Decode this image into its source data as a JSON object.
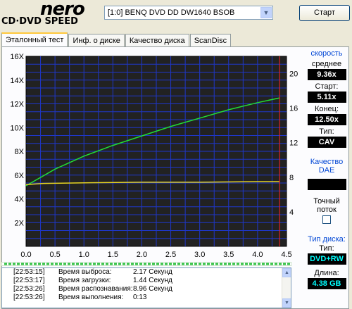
{
  "logo": {
    "brand": "nero",
    "product": "CD·DVD SPEED"
  },
  "drive": {
    "selected": "[1:0]  BENQ DVD DD DW1640 BSOB"
  },
  "start_button": "Старт",
  "tabs": [
    {
      "label": "Эталонный тест",
      "active": true
    },
    {
      "label": "Инф. о диске",
      "active": false
    },
    {
      "label": "Качество диска",
      "active": false
    },
    {
      "label": "ScanDisc",
      "active": false
    }
  ],
  "speed_panel": {
    "title": "скорость",
    "avg_label": "среднее",
    "avg_value": "9.36x",
    "start_label": "Старт:",
    "start_value": "5.11x",
    "end_label": "Конец:",
    "end_value": "12.50x",
    "type_label": "Тип:",
    "type_value": "CAV"
  },
  "dae_panel": {
    "title": "Качество DAE",
    "value": "",
    "precise_label_1": "Точный",
    "precise_label_2": "поток"
  },
  "disc_panel": {
    "title": "Тип диска:",
    "type_label": "Тип:",
    "type_value": "DVD+RW",
    "length_label": "Длина:",
    "length_value": "4.38 GB"
  },
  "log": [
    {
      "time": "[22:53:15]",
      "key": "Время выброса:",
      "value": "2.17 Секунд"
    },
    {
      "time": "[22:53:17]",
      "key": "Время загрузки:",
      "value": "1.44 Секунд"
    },
    {
      "time": "[22:53:26]",
      "key": "Время распознавания:",
      "value": "8.96 Секунд"
    },
    {
      "time": "[22:53:26]",
      "key": "Время выполнения:",
      "value": "0:13"
    }
  ],
  "colors": {
    "accent": "#0046d5",
    "plot_bg": "#222222",
    "grid": "#1f37c9",
    "speed_line": "#22dd33",
    "secondary_line": "#e6d422",
    "marker": "#ff2222"
  },
  "chart_data": {
    "type": "line",
    "xlim": [
      0,
      4.5
    ],
    "ylim": [
      0,
      16
    ],
    "y2lim": [
      0,
      22
    ],
    "x_ticks": [
      "0.0",
      "0.5",
      "1.0",
      "1.5",
      "2.0",
      "2.5",
      "3.0",
      "3.5",
      "4.0",
      "4.5"
    ],
    "y_ticks": [
      "2X",
      "4X",
      "6X",
      "8X",
      "10X",
      "12X",
      "14X",
      "16X"
    ],
    "y2_ticks": [
      "4",
      "8",
      "12",
      "16",
      "20"
    ],
    "grid": true,
    "series": [
      {
        "axis": "left",
        "color": "#22dd33",
        "x": [
          0,
          0.5,
          1.0,
          1.5,
          2.0,
          2.5,
          3.0,
          3.5,
          4.0,
          4.38
        ],
        "y": [
          5.1,
          6.5,
          7.6,
          8.5,
          9.3,
          10.1,
          10.8,
          11.5,
          12.1,
          12.5
        ]
      },
      {
        "axis": "left",
        "color": "#e6d422",
        "x": [
          0,
          0.3,
          1.0,
          2.0,
          3.0,
          4.0,
          4.38
        ],
        "y": [
          5.2,
          5.3,
          5.35,
          5.4,
          5.4,
          5.45,
          5.45
        ]
      }
    ],
    "marker_x": 4.38
  }
}
